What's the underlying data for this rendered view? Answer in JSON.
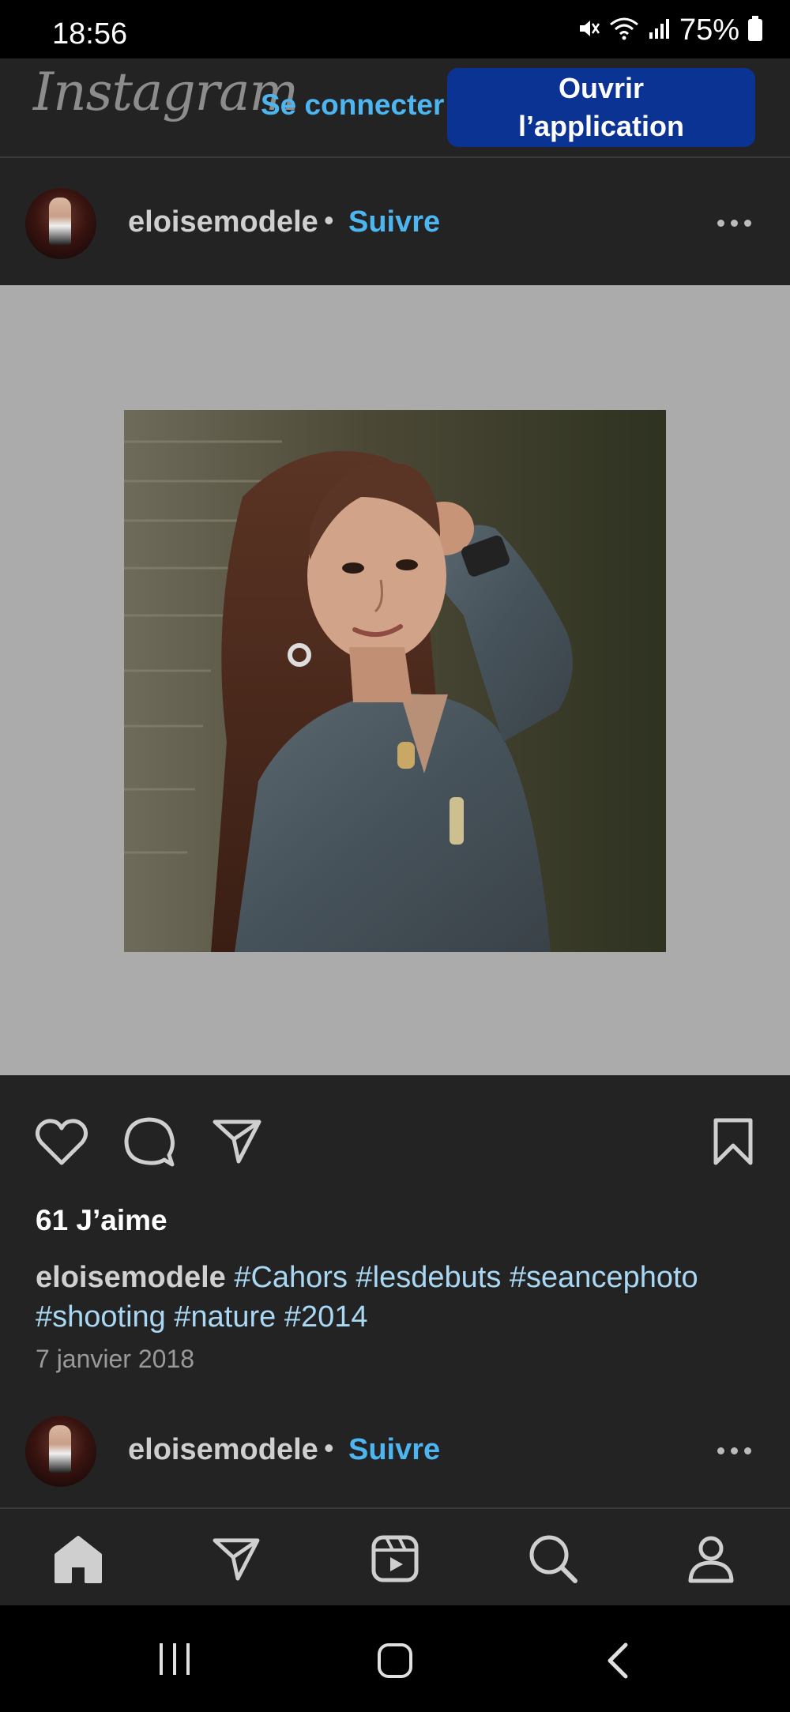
{
  "status_bar": {
    "time": "18:56",
    "battery": "75%"
  },
  "header": {
    "brand": "Instagram",
    "login_label": "Se connecter",
    "open_app_line1": "Ouvrir",
    "open_app_line2": "l’application"
  },
  "post": {
    "username": "eloisemodele",
    "separator": "•",
    "follow_label": "Suivre",
    "likes": "61 J’aime",
    "caption_user": "eloisemodele",
    "hashtags": [
      "#Cahors",
      "#lesdebuts",
      "#seancephoto",
      "#shooting",
      "#nature",
      "#2014"
    ],
    "date": "7 janvier 2018"
  },
  "next_post": {
    "username": "eloisemodele",
    "separator": "•",
    "follow_label": "Suivre"
  },
  "colors": {
    "accent": "#4db5f0",
    "button_bg": "#0a3394",
    "hashtag": "#a9d8f5",
    "background": "#232323",
    "media_bg": "#ababab"
  },
  "icons": {
    "post_actions": [
      "heart-icon",
      "comment-icon",
      "share-icon",
      "bookmark-icon"
    ],
    "bottom_nav": [
      "home-icon",
      "direct-icon",
      "reels-icon",
      "search-icon",
      "profile-icon"
    ],
    "system_nav": [
      "recents-icon",
      "home-button-icon",
      "back-icon"
    ]
  }
}
